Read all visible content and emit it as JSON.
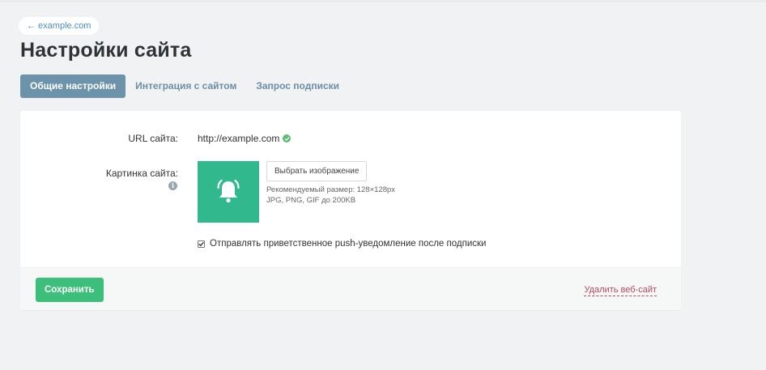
{
  "back_link": {
    "label": "← example.com"
  },
  "page": {
    "title": "Настройки сайта"
  },
  "tabs": [
    {
      "label": "Общие настройки",
      "active": true
    },
    {
      "label": "Интеграция с сайтом",
      "active": false
    },
    {
      "label": "Запрос подписки",
      "active": false
    }
  ],
  "form": {
    "url_label": "URL сайта:",
    "url_value": "http://example.com",
    "image_label": "Картинка сайта:",
    "choose_image_label": "Выбрать изображение",
    "hint_size": "Рекомендуемый размер: 128×128px",
    "hint_formats": "JPG, PNG, GIF до 200KB",
    "welcome_push_label": "Отправлять приветственное push-уведомление после подписки",
    "welcome_push_checked": true
  },
  "footer": {
    "save_label": "Сохранить",
    "delete_label": "Удалить веб-сайт"
  },
  "icons": {
    "back": "arrow-left-icon",
    "verified": "check-circle-icon",
    "info": "info-icon",
    "preview": "bell-icon"
  },
  "colors": {
    "tab_active": "#6d93ab",
    "save_button": "#3cbf7a",
    "preview_bg": "#31b88d",
    "delete_link": "#b24a5c",
    "verified": "#5bbd72"
  }
}
